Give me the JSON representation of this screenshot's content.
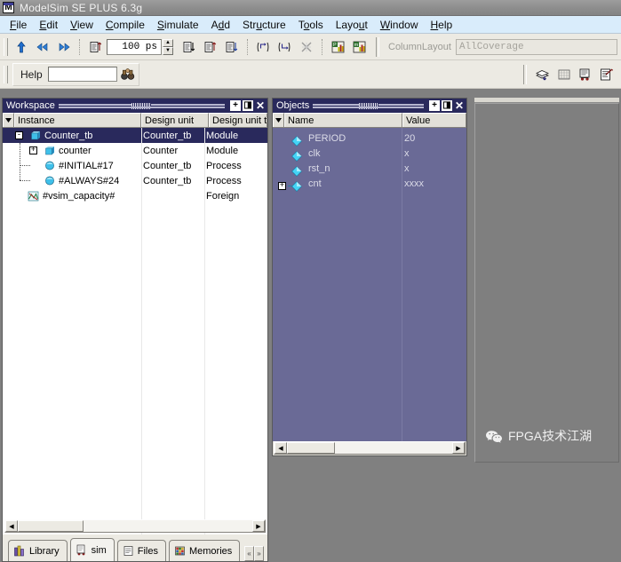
{
  "window": {
    "title": "ModelSim SE PLUS 6.3g",
    "icon": "modelsim-m-icon"
  },
  "menubar": {
    "items": [
      {
        "label": "File",
        "mnemonic": "F"
      },
      {
        "label": "Edit",
        "mnemonic": "E"
      },
      {
        "label": "View",
        "mnemonic": "V"
      },
      {
        "label": "Compile",
        "mnemonic": "C"
      },
      {
        "label": "Simulate",
        "mnemonic": "S"
      },
      {
        "label": "Add",
        "mnemonic": "A"
      },
      {
        "label": "Structure",
        "mnemonic": "u"
      },
      {
        "label": "Tools",
        "mnemonic": "o"
      },
      {
        "label": "Layout",
        "mnemonic": "u"
      },
      {
        "label": "Window",
        "mnemonic": "W"
      },
      {
        "label": "Help",
        "mnemonic": "H"
      }
    ]
  },
  "toolbar_main": {
    "buttons": [
      {
        "name": "step-up-icon"
      },
      {
        "name": "step-back-icon"
      },
      {
        "name": "step-forward-icon"
      },
      {
        "name": "restart-icon"
      },
      {
        "name": "run-icon"
      },
      {
        "name": "run-continue-icon"
      },
      {
        "name": "run-all-icon"
      },
      {
        "name": "step-into-icon"
      },
      {
        "name": "step-over-icon"
      },
      {
        "name": "break-icon"
      },
      {
        "name": "profile-performance-icon"
      },
      {
        "name": "profile-memory-icon"
      }
    ],
    "run_length": "100 ps",
    "columnlayout_label": "ColumnLayout",
    "columnlayout_value": "AllCoverage"
  },
  "toolbar_help": {
    "help_label": "Help",
    "help_value": "",
    "help_placeholder": "",
    "search_icon": "binoculars-search-icon",
    "right_buttons": [
      {
        "name": "dataset-snapshot-icon"
      },
      {
        "name": "grid-icon"
      },
      {
        "name": "wave-compare-icon"
      },
      {
        "name": "annotate-icon"
      }
    ]
  },
  "workspace": {
    "title": "Workspace",
    "titlebar_buttons": [
      {
        "name": "dock-undock-icon",
        "glyph": "+"
      },
      {
        "name": "maximize-panel-icon",
        "glyph": "◨"
      },
      {
        "name": "close-panel-icon",
        "glyph": "✕"
      }
    ],
    "columns": [
      "Instance",
      "Design unit",
      "Design unit ty"
    ],
    "rows": [
      {
        "indent": 0,
        "twisty": "-",
        "icon": "module-icon",
        "instance": "Counter_tb",
        "design_unit": "Counter_tb",
        "design_unit_type": "Module",
        "selected": true
      },
      {
        "indent": 1,
        "twisty": "+",
        "icon": "module-icon",
        "instance": "counter",
        "design_unit": "Counter",
        "design_unit_type": "Module",
        "selected": false
      },
      {
        "indent": 1,
        "twisty": "",
        "icon": "process-icon",
        "instance": "#INITIAL#17",
        "design_unit": "Counter_tb",
        "design_unit_type": "Process",
        "selected": false
      },
      {
        "indent": 1,
        "twisty": "",
        "icon": "process-icon",
        "instance": "#ALWAYS#24",
        "design_unit": "Counter_tb",
        "design_unit_type": "Process",
        "selected": false
      },
      {
        "indent": 0,
        "twisty": "",
        "icon": "foreign-icon",
        "instance": "#vsim_capacity#",
        "design_unit": "",
        "design_unit_type": "Foreign",
        "selected": false
      }
    ],
    "tabs": [
      {
        "label": "Library",
        "icon": "library-icon",
        "active": false
      },
      {
        "label": "sim",
        "icon": "sim-icon",
        "active": true
      },
      {
        "label": "Files",
        "icon": "files-icon",
        "active": false
      },
      {
        "label": "Memories",
        "icon": "memories-icon",
        "active": false
      }
    ],
    "tab_nav": [
      {
        "name": "tab-scroll-left-button",
        "glyph": "«"
      },
      {
        "name": "tab-scroll-right-button",
        "glyph": "»"
      }
    ]
  },
  "objects": {
    "title": "Objects",
    "titlebar_buttons": [
      {
        "name": "dock-undock-icon",
        "glyph": "+"
      },
      {
        "name": "maximize-panel-icon",
        "glyph": "◨"
      },
      {
        "name": "close-panel-icon",
        "glyph": "✕"
      }
    ],
    "columns": [
      "Name",
      "Value"
    ],
    "rows": [
      {
        "twisty": "",
        "icon": "signal-diamond-icon",
        "name": "PERIOD",
        "value": "20"
      },
      {
        "twisty": "",
        "icon": "signal-diamond-icon",
        "name": "clk",
        "value": "x"
      },
      {
        "twisty": "",
        "icon": "signal-diamond-icon",
        "name": "rst_n",
        "value": "x"
      },
      {
        "twisty": "+",
        "icon": "signal-diamond-icon",
        "name": "cnt",
        "value": "xxxx"
      }
    ]
  },
  "scrollbars": {
    "left_arrow": "◀",
    "right_arrow": "▶"
  },
  "watermark": {
    "text": "FPGA技术江湖",
    "icon": "wechat-icon"
  },
  "colors": {
    "panel_title_bg": "#29295c",
    "objects_bg": "#6a6a96",
    "menubar_bg": "#d9ecfb",
    "toolbar_bg": "#eceae3",
    "mdi_bg": "#808080",
    "selection_bg": "#29295c"
  }
}
